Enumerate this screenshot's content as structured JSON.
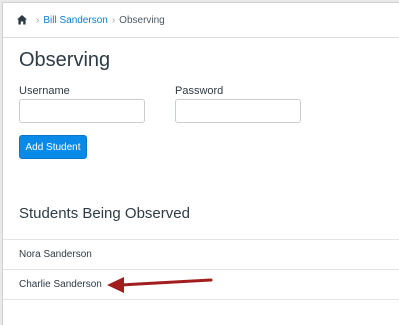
{
  "breadcrumb": {
    "home_icon": "home-icon",
    "separator": "›",
    "user_link": "Bill Sanderson",
    "current": "Observing"
  },
  "page": {
    "title": "Observing",
    "username_label": "Username",
    "password_label": "Password",
    "username_value": "",
    "password_value": "",
    "add_button": "Add Student"
  },
  "students": {
    "heading": "Students Being Observed",
    "items": [
      "Nora Sanderson",
      "Charlie Sanderson"
    ]
  },
  "colors": {
    "accent": "#0a8ae8",
    "arrow": "#a21e1e"
  }
}
